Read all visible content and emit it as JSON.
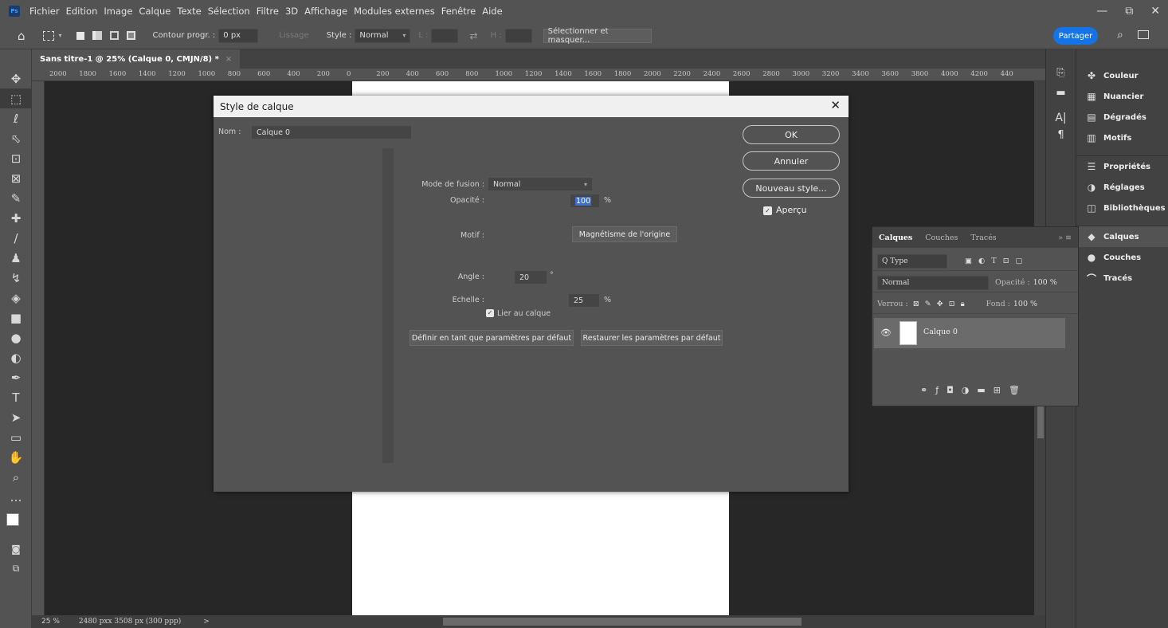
{
  "menubar": {
    "logo": "Ps",
    "items": [
      "Fichier",
      "Edition",
      "Image",
      "Calque",
      "Texte",
      "Sélection",
      "Filtre",
      "3D",
      "Affichage",
      "Modules externes",
      "Fenêtre",
      "Aide"
    ],
    "window_controls": [
      "—",
      "⧉",
      "✕"
    ]
  },
  "optionsbar": {
    "home_icon": "⌂",
    "contour_label": "Contour progr. :",
    "contour_value": "0 px",
    "lissage_label": "Lissage",
    "style_label": "Style :",
    "style_value": "Normal",
    "l_label": "L :",
    "h_label": "H :",
    "select_mask_button": "Sélectionner et masquer...",
    "share_button": "Partager"
  },
  "tools": [
    "✥",
    "⬚",
    "ℓ",
    "⬁",
    "⊡",
    "⊠",
    "✎",
    "✚",
    "/",
    "♟",
    "↯",
    "◈",
    "■",
    "●",
    "◐",
    "✒",
    "T",
    "➤",
    "▭",
    "✋",
    "⌕",
    "…"
  ],
  "document": {
    "tab_title": "Sans titre-1 @ 25% (Calque 0, CMJN/8) *",
    "ruler_labels": [
      "2000",
      "1800",
      "1600",
      "1400",
      "1200",
      "1000",
      "800",
      "600",
      "400",
      "200",
      "0",
      "200",
      "400",
      "600",
      "800",
      "1000",
      "1200",
      "1400",
      "1600",
      "1800",
      "2000",
      "2200",
      "2400",
      "2600",
      "2800",
      "3000",
      "3200",
      "3400",
      "3600",
      "3800",
      "4000",
      "4200",
      "440"
    ],
    "zoom": "25 %",
    "doc_size": "2480 pxx 3508 px (300 ppp)",
    "status_arrow": ">"
  },
  "dialog": {
    "title": "Style de calque",
    "name_label": "Nom :",
    "name_value": "Calque 0",
    "blend_mode_label": "Mode de fusion :",
    "blend_mode_value": "Normal",
    "opacity_label": "Opacité :",
    "opacity_value": "100",
    "percent": "%",
    "pattern_label": "Motif :",
    "snap_origin_button": "Magnétisme de l'origine",
    "angle_label": "Angle :",
    "angle_value": "20",
    "degree": "°",
    "scale_label": "Echelle :",
    "scale_value": "25",
    "link_layer_label": "Lier au calque",
    "set_default_button": "Définir en tant que paramètres par défaut",
    "reset_default_button": "Restaurer les paramètres par défaut",
    "ok_button": "OK",
    "cancel_button": "Annuler",
    "new_style_button": "Nouveau style...",
    "preview_label": "Aperçu"
  },
  "layers_panel": {
    "tabs": [
      "Calques",
      "Couches",
      "Tracés"
    ],
    "filter_value": "Q Type",
    "blend_value": "Normal",
    "opacity_label": "Opacité :",
    "opacity_value": "100 %",
    "lock_label": "Verrou :",
    "fill_label": "Fond :",
    "fill_value": "100 %",
    "layer_name": "Calque 0"
  },
  "panel_dock": {
    "items": [
      "Couleur",
      "Nuancier",
      "Dégradés",
      "Motifs",
      "Propriétés",
      "Réglages",
      "Bibliothèques",
      "Calques",
      "Couches",
      "Tracés"
    ]
  }
}
